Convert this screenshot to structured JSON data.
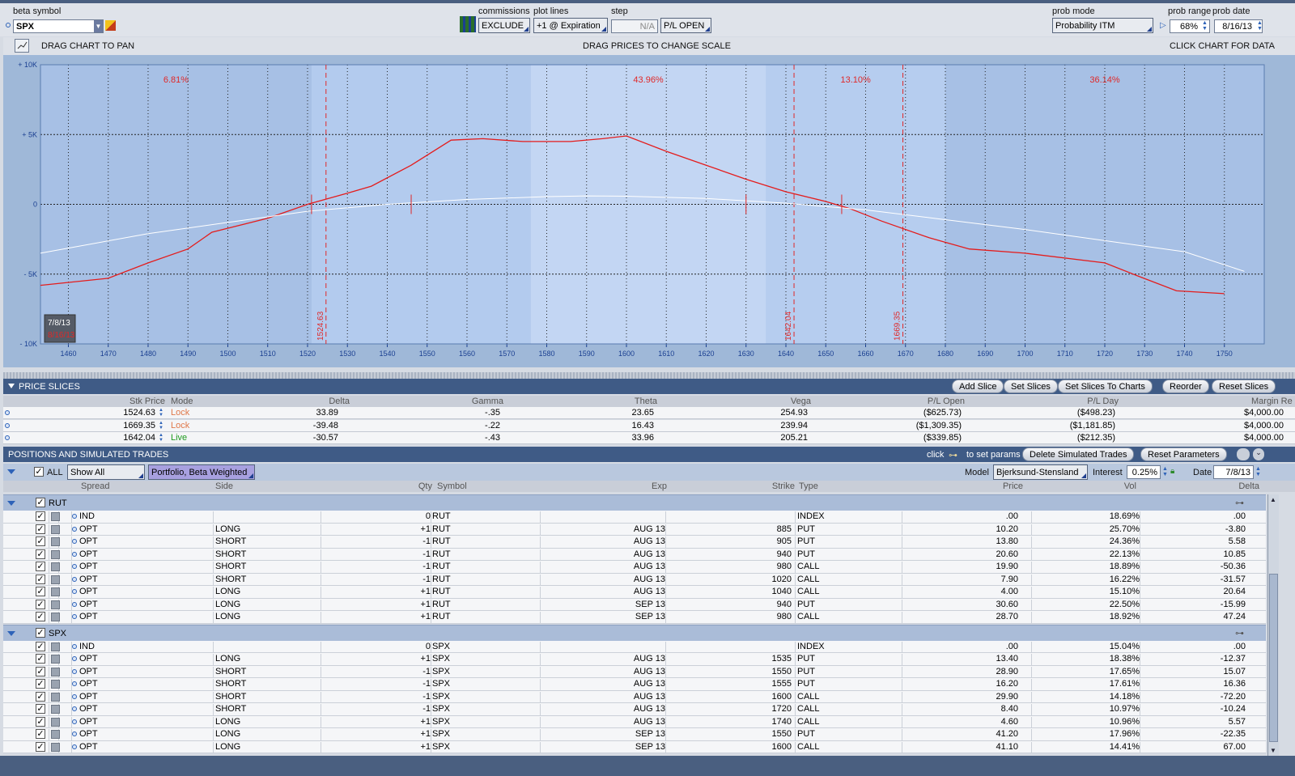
{
  "controls": {
    "beta_symbol_label": "beta symbol",
    "beta_symbol_value": "SPX",
    "commissions_label": "commissions",
    "commissions_value": "EXCLUDE",
    "plot_lines_label": "plot lines",
    "plot_lines_value": "+1 @ Expiration",
    "step_label": "step",
    "step_value": "N/A",
    "pl_mode_value": "P/L OPEN",
    "prob_mode_label": "prob mode",
    "prob_mode_value": "Probability ITM",
    "prob_range_label": "prob range",
    "prob_range_value": "68%",
    "prob_date_label": "prob date",
    "prob_date_value": "8/16/13"
  },
  "chartbar": {
    "pan_text": "DRAG CHART TO PAN",
    "scale_text": "DRAG PRICES TO CHANGE SCALE",
    "click_text": "CLICK CHART FOR DATA"
  },
  "chart_data": {
    "type": "line",
    "xlim": [
      1453,
      1760
    ],
    "ylim": [
      -10000,
      10000
    ],
    "x_ticks": [
      1460,
      1470,
      1480,
      1490,
      1500,
      1510,
      1520,
      1530,
      1540,
      1550,
      1560,
      1570,
      1580,
      1590,
      1600,
      1610,
      1620,
      1630,
      1640,
      1650,
      1660,
      1670,
      1680,
      1690,
      1700,
      1710,
      1720,
      1730,
      1740,
      1750
    ],
    "y_ticks": [
      {
        "v": 10000,
        "label": "+ 10K"
      },
      {
        "v": 5000,
        "label": "+ 5K"
      },
      {
        "v": 0,
        "label": "0"
      },
      {
        "v": -5000,
        "label": "- 5K"
      },
      {
        "v": -10000,
        "label": "- 10K"
      }
    ],
    "series": [
      {
        "color": "#e41c1c",
        "points": [
          [
            1453,
            -5800
          ],
          [
            1470,
            -5300
          ],
          [
            1480,
            -4200
          ],
          [
            1490,
            -3200
          ],
          [
            1496,
            -2000
          ],
          [
            1510,
            -1000
          ],
          [
            1520,
            0
          ],
          [
            1530,
            800
          ],
          [
            1536,
            1300
          ],
          [
            1546,
            2800
          ],
          [
            1556,
            4600
          ],
          [
            1564,
            4700
          ],
          [
            1574,
            4500
          ],
          [
            1586,
            4500
          ],
          [
            1594,
            4700
          ],
          [
            1600,
            4900
          ],
          [
            1610,
            3800
          ],
          [
            1620,
            2800
          ],
          [
            1630,
            1800
          ],
          [
            1640,
            900
          ],
          [
            1650,
            200
          ],
          [
            1656,
            -300
          ],
          [
            1664,
            -1200
          ],
          [
            1676,
            -2400
          ],
          [
            1686,
            -3200
          ],
          [
            1700,
            -3500
          ],
          [
            1720,
            -4200
          ],
          [
            1728,
            -5100
          ],
          [
            1738,
            -6200
          ],
          [
            1750,
            -6400
          ]
        ]
      },
      {
        "color": "#ffffff",
        "points": [
          [
            1453,
            -3500
          ],
          [
            1480,
            -2100
          ],
          [
            1500,
            -1300
          ],
          [
            1520,
            -500
          ],
          [
            1540,
            0
          ],
          [
            1560,
            350
          ],
          [
            1580,
            550
          ],
          [
            1590,
            600
          ],
          [
            1600,
            580
          ],
          [
            1620,
            420
          ],
          [
            1640,
            80
          ],
          [
            1660,
            -400
          ],
          [
            1680,
            -1100
          ],
          [
            1700,
            -1800
          ],
          [
            1720,
            -2600
          ],
          [
            1740,
            -3400
          ],
          [
            1755,
            -4800
          ]
        ]
      }
    ],
    "zones": [
      {
        "from": 1453,
        "to": 1521,
        "label": "6.81%"
      },
      {
        "from": 1521,
        "to": 1576,
        "label": ""
      },
      {
        "from": 1576,
        "to": 1635,
        "label": "43.96%"
      },
      {
        "from": 1635,
        "to": 1680,
        "label": "13.10%"
      },
      {
        "from": 1680,
        "to": 1760,
        "label": "36.14%"
      }
    ],
    "slice_lines": [
      {
        "x": 1524.63,
        "label": "1524.63"
      },
      {
        "x": 1642.04,
        "label": "1642.04"
      },
      {
        "x": 1669.35,
        "label": "1669.35"
      }
    ],
    "ticks_marks": [
      1521,
      1546,
      1630,
      1654
    ],
    "date_badge": {
      "date": "7/8/13",
      "sub": "8/16/13"
    }
  },
  "price_slices": {
    "title": "PRICE SLICES",
    "buttons": [
      "Add Slice",
      "Set Slices",
      "Set Slices To Charts",
      "Reorder",
      "Reset Slices"
    ],
    "headers": [
      "Stk Price",
      "Mode",
      "Delta",
      "Gamma",
      "Theta",
      "Vega",
      "P/L Open",
      "P/L Day",
      "Margin Re"
    ],
    "rows": [
      {
        "price": "1524.63",
        "mode": "Lock",
        "delta": "33.89",
        "gamma": "-.35",
        "theta": "23.65",
        "vega": "254.93",
        "pl_open": "($625.73)",
        "pl_day": "($498.23)",
        "margin": "$4,000.00"
      },
      {
        "price": "1669.35",
        "mode": "Lock",
        "delta": "-39.48",
        "gamma": "-.22",
        "theta": "16.43",
        "vega": "239.94",
        "pl_open": "($1,309.35)",
        "pl_day": "($1,181.85)",
        "margin": "$4,000.00"
      },
      {
        "price": "1642.04",
        "mode": "Live",
        "delta": "-30.57",
        "gamma": "-.43",
        "theta": "33.96",
        "vega": "205.21",
        "pl_open": "($339.85)",
        "pl_day": "($212.35)",
        "margin": "$4,000.00"
      }
    ]
  },
  "positions": {
    "title": "POSITIONS AND SIMULATED TRADES",
    "click_text": "click",
    "set_params_text": "to set params",
    "delete_btn": "Delete Simulated Trades",
    "reset_btn": "Reset Parameters",
    "all_label": "ALL",
    "show_value": "Show All",
    "portfolio_value": "Portfolio, Beta Weighted",
    "model_label": "Model",
    "model_value": "Bjerksund-Stensland",
    "interest_label": "Interest",
    "interest_value": "0.25%",
    "date_label": "Date",
    "date_value": "7/8/13",
    "headers": [
      "Spread",
      "Side",
      "Qty",
      "Symbol",
      "Exp",
      "Strike",
      "Type",
      "Price",
      "Vol",
      "Delta"
    ],
    "groups": [
      {
        "name": "RUT",
        "rows": [
          {
            "spread": "IND",
            "side": "",
            "qty": "0",
            "symbol": "RUT",
            "exp": "",
            "strike": "",
            "type": "INDEX",
            "price": ".00",
            "vol": "18.69%",
            "delta": ".00"
          },
          {
            "spread": "OPT",
            "side": "LONG",
            "qty": "+1",
            "symbol": "RUT",
            "exp": "AUG 13",
            "strike": "885",
            "type": "PUT",
            "price": "10.20",
            "vol": "25.70%",
            "delta": "-3.80"
          },
          {
            "spread": "OPT",
            "side": "SHORT",
            "qty": "-1",
            "symbol": "RUT",
            "exp": "AUG 13",
            "strike": "905",
            "type": "PUT",
            "price": "13.80",
            "vol": "24.36%",
            "delta": "5.58"
          },
          {
            "spread": "OPT",
            "side": "SHORT",
            "qty": "-1",
            "symbol": "RUT",
            "exp": "AUG 13",
            "strike": "940",
            "type": "PUT",
            "price": "20.60",
            "vol": "22.13%",
            "delta": "10.85"
          },
          {
            "spread": "OPT",
            "side": "SHORT",
            "qty": "-1",
            "symbol": "RUT",
            "exp": "AUG 13",
            "strike": "980",
            "type": "CALL",
            "price": "19.90",
            "vol": "18.89%",
            "delta": "-50.36"
          },
          {
            "spread": "OPT",
            "side": "SHORT",
            "qty": "-1",
            "symbol": "RUT",
            "exp": "AUG 13",
            "strike": "1020",
            "type": "CALL",
            "price": "7.90",
            "vol": "16.22%",
            "delta": "-31.57"
          },
          {
            "spread": "OPT",
            "side": "LONG",
            "qty": "+1",
            "symbol": "RUT",
            "exp": "AUG 13",
            "strike": "1040",
            "type": "CALL",
            "price": "4.00",
            "vol": "15.10%",
            "delta": "20.64"
          },
          {
            "spread": "OPT",
            "side": "LONG",
            "qty": "+1",
            "symbol": "RUT",
            "exp": "SEP 13",
            "strike": "940",
            "type": "PUT",
            "price": "30.60",
            "vol": "22.50%",
            "delta": "-15.99"
          },
          {
            "spread": "OPT",
            "side": "LONG",
            "qty": "+1",
            "symbol": "RUT",
            "exp": "SEP 13",
            "strike": "980",
            "type": "CALL",
            "price": "28.70",
            "vol": "18.92%",
            "delta": "47.24"
          }
        ]
      },
      {
        "name": "SPX",
        "rows": [
          {
            "spread": "IND",
            "side": "",
            "qty": "0",
            "symbol": "SPX",
            "exp": "",
            "strike": "",
            "type": "INDEX",
            "price": ".00",
            "vol": "15.04%",
            "delta": ".00"
          },
          {
            "spread": "OPT",
            "side": "LONG",
            "qty": "+1",
            "symbol": "SPX",
            "exp": "AUG 13",
            "strike": "1535",
            "type": "PUT",
            "price": "13.40",
            "vol": "18.38%",
            "delta": "-12.37"
          },
          {
            "spread": "OPT",
            "side": "SHORT",
            "qty": "-1",
            "symbol": "SPX",
            "exp": "AUG 13",
            "strike": "1550",
            "type": "PUT",
            "price": "28.90",
            "vol": "17.65%",
            "delta": "15.07"
          },
          {
            "spread": "OPT",
            "side": "SHORT",
            "qty": "-1",
            "symbol": "SPX",
            "exp": "AUG 13",
            "strike": "1555",
            "type": "PUT",
            "price": "16.20",
            "vol": "17.61%",
            "delta": "16.36"
          },
          {
            "spread": "OPT",
            "side": "SHORT",
            "qty": "-1",
            "symbol": "SPX",
            "exp": "AUG 13",
            "strike": "1600",
            "type": "CALL",
            "price": "29.90",
            "vol": "14.18%",
            "delta": "-72.20"
          },
          {
            "spread": "OPT",
            "side": "SHORT",
            "qty": "-1",
            "symbol": "SPX",
            "exp": "AUG 13",
            "strike": "1720",
            "type": "CALL",
            "price": "8.40",
            "vol": "10.97%",
            "delta": "-10.24"
          },
          {
            "spread": "OPT",
            "side": "LONG",
            "qty": "+1",
            "symbol": "SPX",
            "exp": "AUG 13",
            "strike": "1740",
            "type": "CALL",
            "price": "4.60",
            "vol": "10.96%",
            "delta": "5.57"
          },
          {
            "spread": "OPT",
            "side": "LONG",
            "qty": "+1",
            "symbol": "SPX",
            "exp": "SEP 13",
            "strike": "1550",
            "type": "PUT",
            "price": "41.20",
            "vol": "17.96%",
            "delta": "-22.35"
          },
          {
            "spread": "OPT",
            "side": "LONG",
            "qty": "+1",
            "symbol": "SPX",
            "exp": "SEP 13",
            "strike": "1600",
            "type": "CALL",
            "price": "41.10",
            "vol": "14.41%",
            "delta": "67.00"
          }
        ]
      }
    ]
  }
}
